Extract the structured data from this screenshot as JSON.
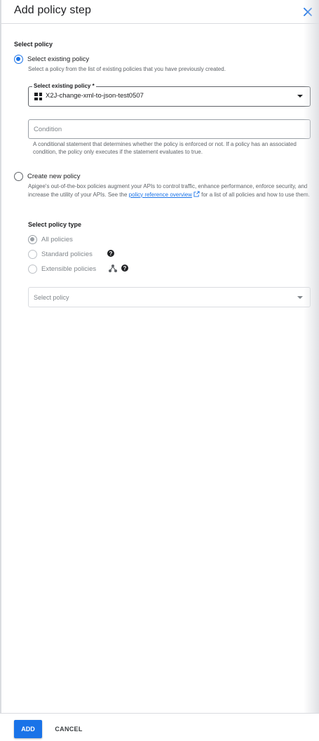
{
  "header": {
    "title": "Add policy step",
    "close_icon": "close-icon"
  },
  "select_policy": {
    "section_title": "Select policy",
    "existing": {
      "label": "Select existing policy",
      "description": "Select a policy from the list of existing policies that you have previously created.",
      "selected": true,
      "field": {
        "legend": "Select existing policy *",
        "value": "X2J-change-xml-to-json-test0507"
      },
      "condition": {
        "placeholder": "Condition",
        "hint": "A conditional statement that determines whether the policy is enforced or not. If a policy has an associated condition, the policy only executes if the statement evaluates to true."
      }
    },
    "create_new": {
      "label": "Create new policy",
      "description_pre": "Apigee's out-of-the-box policies augment your APIs to control traffic, enhance performance, enforce security, and increase the utility of your APIs. See the ",
      "link_text": "policy reference overview",
      "description_post": " for a list of all policies and how to use them.",
      "selected": false
    }
  },
  "policy_type": {
    "title": "Select policy type",
    "options": [
      {
        "label": "All policies",
        "selected": true
      },
      {
        "label": "Standard policies",
        "selected": false
      },
      {
        "label": "Extensible policies",
        "selected": false
      }
    ],
    "select_placeholder": "Select policy"
  },
  "footer": {
    "add_label": "ADD",
    "cancel_label": "CANCEL"
  },
  "colors": {
    "accent": "#1a73e8",
    "text": "#202124",
    "muted": "#5f6368",
    "disabled": "#80868b"
  }
}
